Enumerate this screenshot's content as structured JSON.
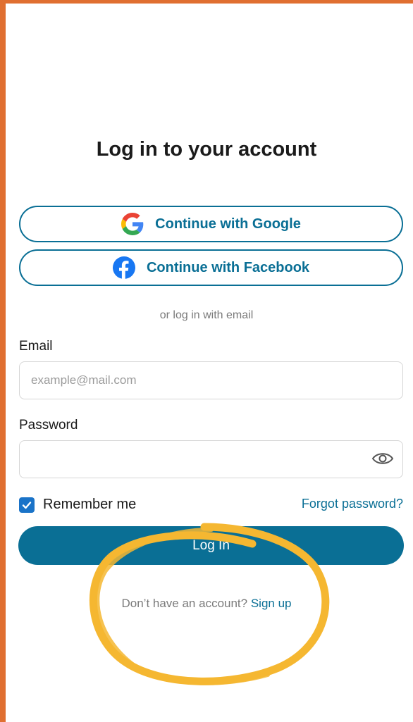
{
  "title": "Log in to your account",
  "social": {
    "google_label": "Continue with Google",
    "facebook_label": "Continue with Facebook"
  },
  "divider": "or log in with email",
  "email": {
    "label": "Email",
    "placeholder": "example@mail.com",
    "value": ""
  },
  "password": {
    "label": "Password",
    "value": ""
  },
  "remember": {
    "label": "Remember me",
    "checked": true
  },
  "forgot_label": "Forgot password?",
  "login_label": "Log In",
  "signup": {
    "prompt": "Don’t have an account?",
    "link": "Sign up"
  },
  "colors": {
    "frame": "#e06f31",
    "accent": "#0a6f95",
    "checkbox": "#1a73c8",
    "highlight": "#f5b731"
  },
  "icons": [
    "google-icon",
    "facebook-icon",
    "eye-icon",
    "checkmark-icon"
  ]
}
